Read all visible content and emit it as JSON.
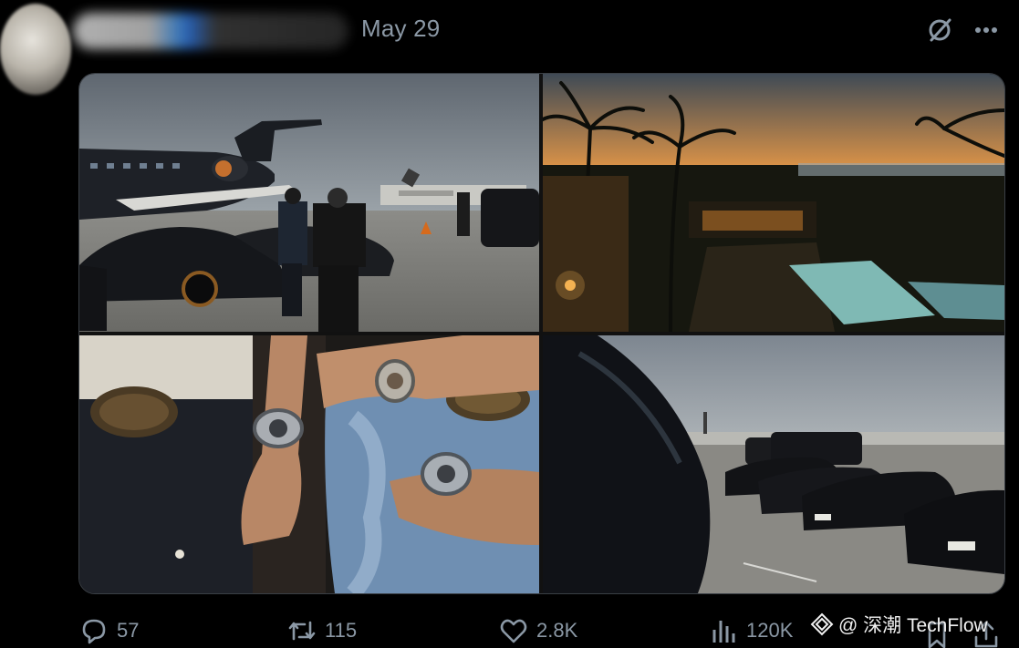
{
  "post": {
    "date": "May 29"
  },
  "icons": {
    "grok": "grok-icon",
    "more": "more-icon",
    "reply": "reply-icon",
    "retweet": "retweet-icon",
    "like": "like-icon",
    "views": "views-icon",
    "bookmark": "bookmark-icon",
    "share": "share-icon",
    "watermark_logo": "watermark-logo-icon"
  },
  "media": {
    "images": [
      {
        "subject": "private-jet-and-supercars"
      },
      {
        "subject": "sunset-villa-pool"
      },
      {
        "subject": "luxury-watches-and-belts"
      },
      {
        "subject": "black-cars-on-tarmac"
      }
    ]
  },
  "actions": {
    "replies": "57",
    "reposts": "115",
    "likes": "2.8K",
    "views": "120K"
  },
  "watermark": {
    "text": "@ 深潮 TechFlow"
  },
  "colors": {
    "background": "#000000",
    "muted_text": "#8b98a5",
    "border": "#3a3f45"
  }
}
